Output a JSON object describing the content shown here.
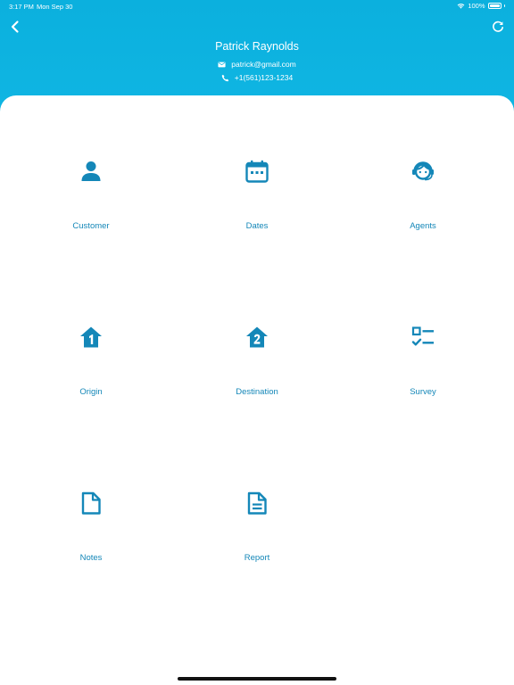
{
  "status_bar": {
    "time": "3:17 PM",
    "date": "Mon Sep 30",
    "battery": "100%"
  },
  "profile": {
    "name": "Patrick Raynolds",
    "email": "patrick@gmail.com",
    "phone": "+1(561)123-1234"
  },
  "menu": [
    {
      "label": "Customer",
      "icon": "person-icon"
    },
    {
      "label": "Dates",
      "icon": "calendar-icon"
    },
    {
      "label": "Agents",
      "icon": "agent-headset-icon"
    },
    {
      "label": "Origin",
      "icon": "home-one-icon"
    },
    {
      "label": "Destination",
      "icon": "home-two-icon"
    },
    {
      "label": "Survey",
      "icon": "checklist-icon"
    },
    {
      "label": "Notes",
      "icon": "note-icon"
    },
    {
      "label": "Report",
      "icon": "report-icon"
    }
  ],
  "colors": {
    "header": "#10b6e3",
    "accent": "#1487b8",
    "label": "#1487b8"
  }
}
